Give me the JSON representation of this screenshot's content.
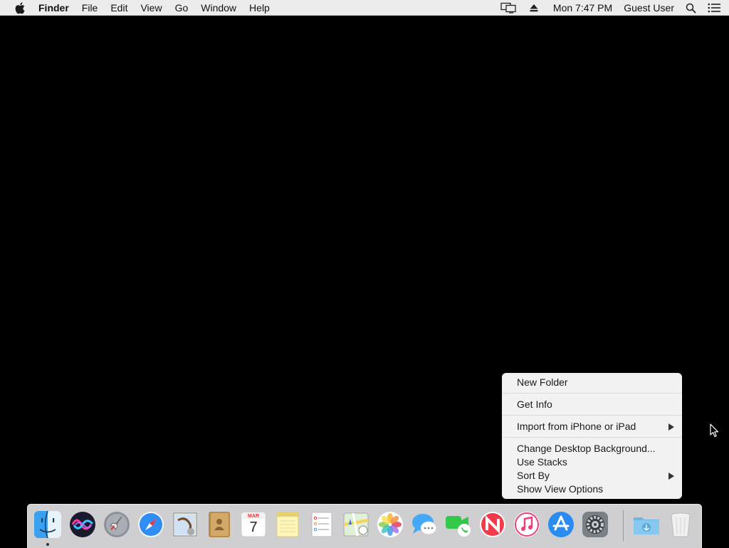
{
  "menubar": {
    "app_name": "Finder",
    "menus": [
      "File",
      "Edit",
      "View",
      "Go",
      "Window",
      "Help"
    ],
    "clock": "Mon 7:47 PM",
    "user": "Guest User",
    "status_icons": [
      "display-mirroring-icon",
      "eject-icon",
      "spotlight-search-icon",
      "notification-center-icon"
    ]
  },
  "context_menu": {
    "groups": [
      [
        {
          "label": "New Folder",
          "submenu": false
        }
      ],
      [
        {
          "label": "Get Info",
          "submenu": false
        }
      ],
      [
        {
          "label": "Import from iPhone or iPad",
          "submenu": true
        }
      ],
      [
        {
          "label": "Change Desktop Background...",
          "submenu": false
        },
        {
          "label": "Use Stacks",
          "submenu": false
        },
        {
          "label": "Sort By",
          "submenu": true
        },
        {
          "label": "Show View Options",
          "submenu": false
        }
      ]
    ]
  },
  "dock": {
    "apps": [
      "finder-icon",
      "siri-icon",
      "launchpad-icon",
      "safari-icon",
      "mail-icon",
      "contacts-icon",
      "calendar-icon",
      "notes-icon",
      "reminders-icon",
      "maps-icon",
      "photos-icon",
      "messages-icon",
      "facetime-icon",
      "news-icon",
      "itunes-icon",
      "app-store-icon",
      "system-preferences-icon"
    ],
    "calendar_month": "MAR",
    "calendar_day": "7",
    "others": [
      "downloads-folder-icon",
      "trash-icon"
    ],
    "running": [
      "finder-icon"
    ]
  },
  "colors": {
    "desktop": "#000000",
    "menubar": "#ececec",
    "menu_bg": "#f2f2f2",
    "dock_bg": "#e1e1e4"
  }
}
